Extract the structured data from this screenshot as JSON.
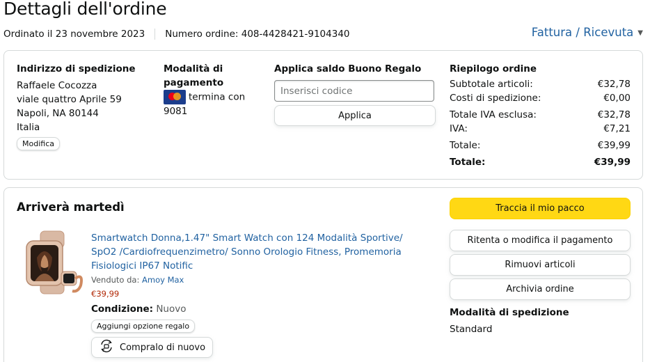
{
  "page": {
    "title": "Dettagli dell'ordine",
    "ordered_on": "Ordinato il 23 novembre 2023",
    "order_number": "Numero ordine: 408-4428421-9104340",
    "invoice_link": "Fattura / Ricevuta"
  },
  "shipping_address": {
    "heading": "Indirizzo di spedizione",
    "name": "Raffaele Cocozza",
    "street": "viale quattro Aprile 59",
    "city": "Napoli, NA 80144",
    "country": "Italia",
    "edit_label": "Modifica"
  },
  "payment": {
    "heading": "Modalità di pagamento",
    "card_text": "termina con 9081"
  },
  "gift_card": {
    "heading": "Applica saldo Buono Regalo",
    "placeholder": "Inserisci codice",
    "apply_label": "Applica"
  },
  "summary": {
    "heading": "Riepilogo ordine",
    "rows": [
      {
        "label": "Subtotale articoli:",
        "value": "€32,78"
      },
      {
        "label": "Costi di spedizione:",
        "value": "€0,00"
      },
      {
        "label": "Totale IVA esclusa:",
        "value": "€32,78"
      },
      {
        "label": "IVA:",
        "value": "€7,21"
      },
      {
        "label": "Totale:",
        "value": "€39,99"
      },
      {
        "label": "Totale:",
        "value": "€39,99"
      }
    ]
  },
  "shipment": {
    "heading": "Arriverà martedì",
    "product_title": "Smartwatch Donna,1.47\" Smart Watch con 124 Modalità Sportive/ SpO2 /Cardiofrequenzimetro/ Sonno Orologio Fitness, Promemoria Fisiologici IP67 Notific",
    "sold_by_label": "Venduto da:",
    "seller": "Amoy Max",
    "price": "€39,99",
    "condition_label": "Condizione:",
    "condition_value": "Nuovo",
    "gift_option_label": "Aggiungi opzione regalo",
    "buy_again_label": "Compralo di nuovo"
  },
  "actions": {
    "track": "Traccia il mio pacco",
    "retry_payment": "Ritenta o modifica il pagamento",
    "remove_items": "Rimuovi articoli",
    "archive": "Archivia ordine",
    "shipping_method_heading": "Modalità di spedizione",
    "shipping_method_value": "Standard"
  },
  "colors": {
    "link": "#2162a1",
    "price": "#b12704",
    "primary_button": "#ffd814",
    "border": "#d5d9d9"
  }
}
